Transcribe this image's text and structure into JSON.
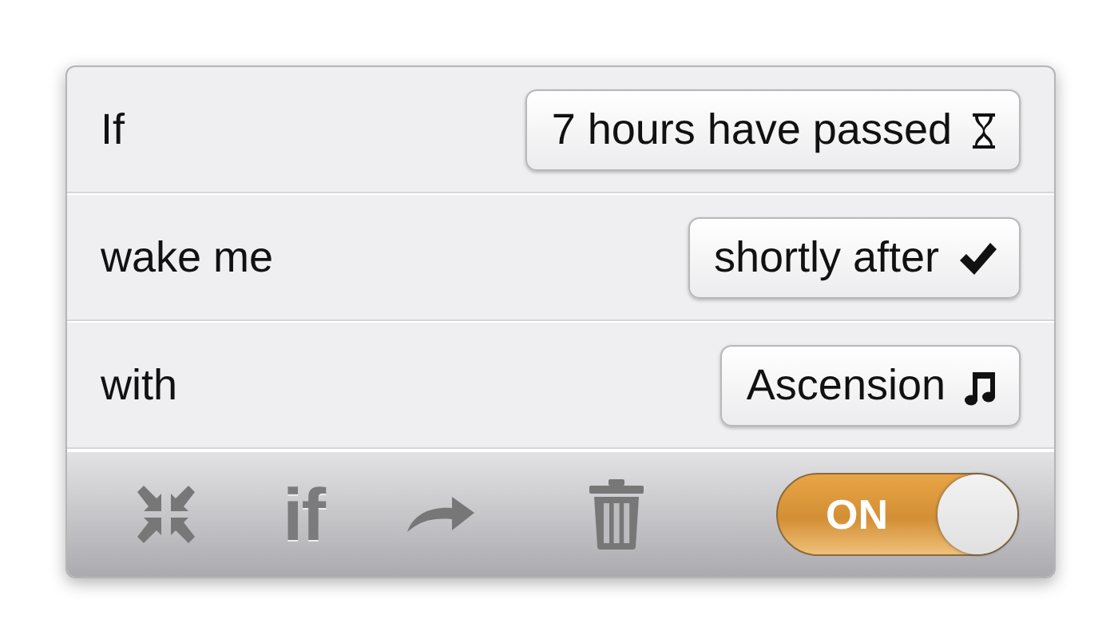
{
  "rows": [
    {
      "label": "If",
      "value": "7 hours have passed"
    },
    {
      "label": "wake me",
      "value": "shortly after"
    },
    {
      "label": "with",
      "value": "Ascension"
    }
  ],
  "toolbar": {
    "if_label": "if",
    "toggle": {
      "label": "ON",
      "on": true
    }
  }
}
